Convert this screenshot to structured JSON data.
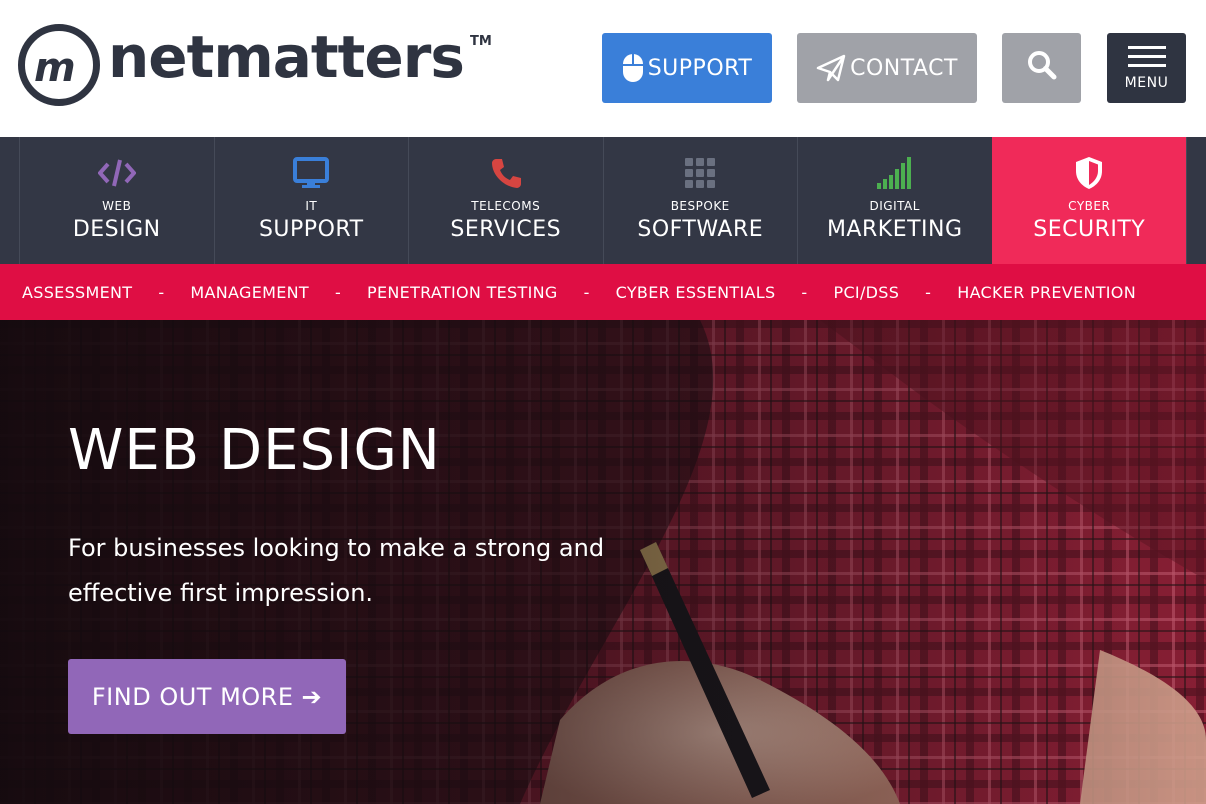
{
  "header": {
    "logo_mark": "m",
    "logo_word": "netmatters",
    "logo_tm": "TM",
    "support_label": "SUPPORT",
    "contact_label": "CONTACT",
    "search_icon": "search-icon",
    "menu_label": "MENU"
  },
  "services": [
    {
      "small": "WEB",
      "big": "DESIGN",
      "icon": "code-icon",
      "color": "#9167b8"
    },
    {
      "small": "IT",
      "big": "SUPPORT",
      "icon": "monitor-icon",
      "color": "#3a7fd9"
    },
    {
      "small": "TELECOMS",
      "big": "SERVICES",
      "icon": "phone-icon",
      "color": "#d64541"
    },
    {
      "small": "BESPOKE",
      "big": "SOFTWARE",
      "icon": "grid-icon",
      "color": "#6a7080"
    },
    {
      "small": "DIGITAL",
      "big": "MARKETING",
      "icon": "signal-bars-icon",
      "color": "#4caf50"
    },
    {
      "small": "CYBER",
      "big": "SECURITY",
      "icon": "shield-icon",
      "color": "#ffffff",
      "active": true
    }
  ],
  "subnav": {
    "items": [
      "ASSESSMENT",
      "MANAGEMENT",
      "PENETRATION TESTING",
      "CYBER ESSENTIALS",
      "PCI/DSS",
      "HACKER PREVENTION"
    ],
    "separator": "-"
  },
  "hero": {
    "title": "WEB DESIGN",
    "subtitle": "For businesses looking to make a strong and effective first impression.",
    "cta_label": "FIND OUT MORE",
    "cta_arrow": "➔"
  },
  "colors": {
    "support_blue": "#3a7fd9",
    "contact_grey": "#a0a2a8",
    "dark_navy": "#333745",
    "cyber_pink": "#f02a59",
    "subnav_red": "#df0e44",
    "cta_purple": "#9167b8"
  }
}
